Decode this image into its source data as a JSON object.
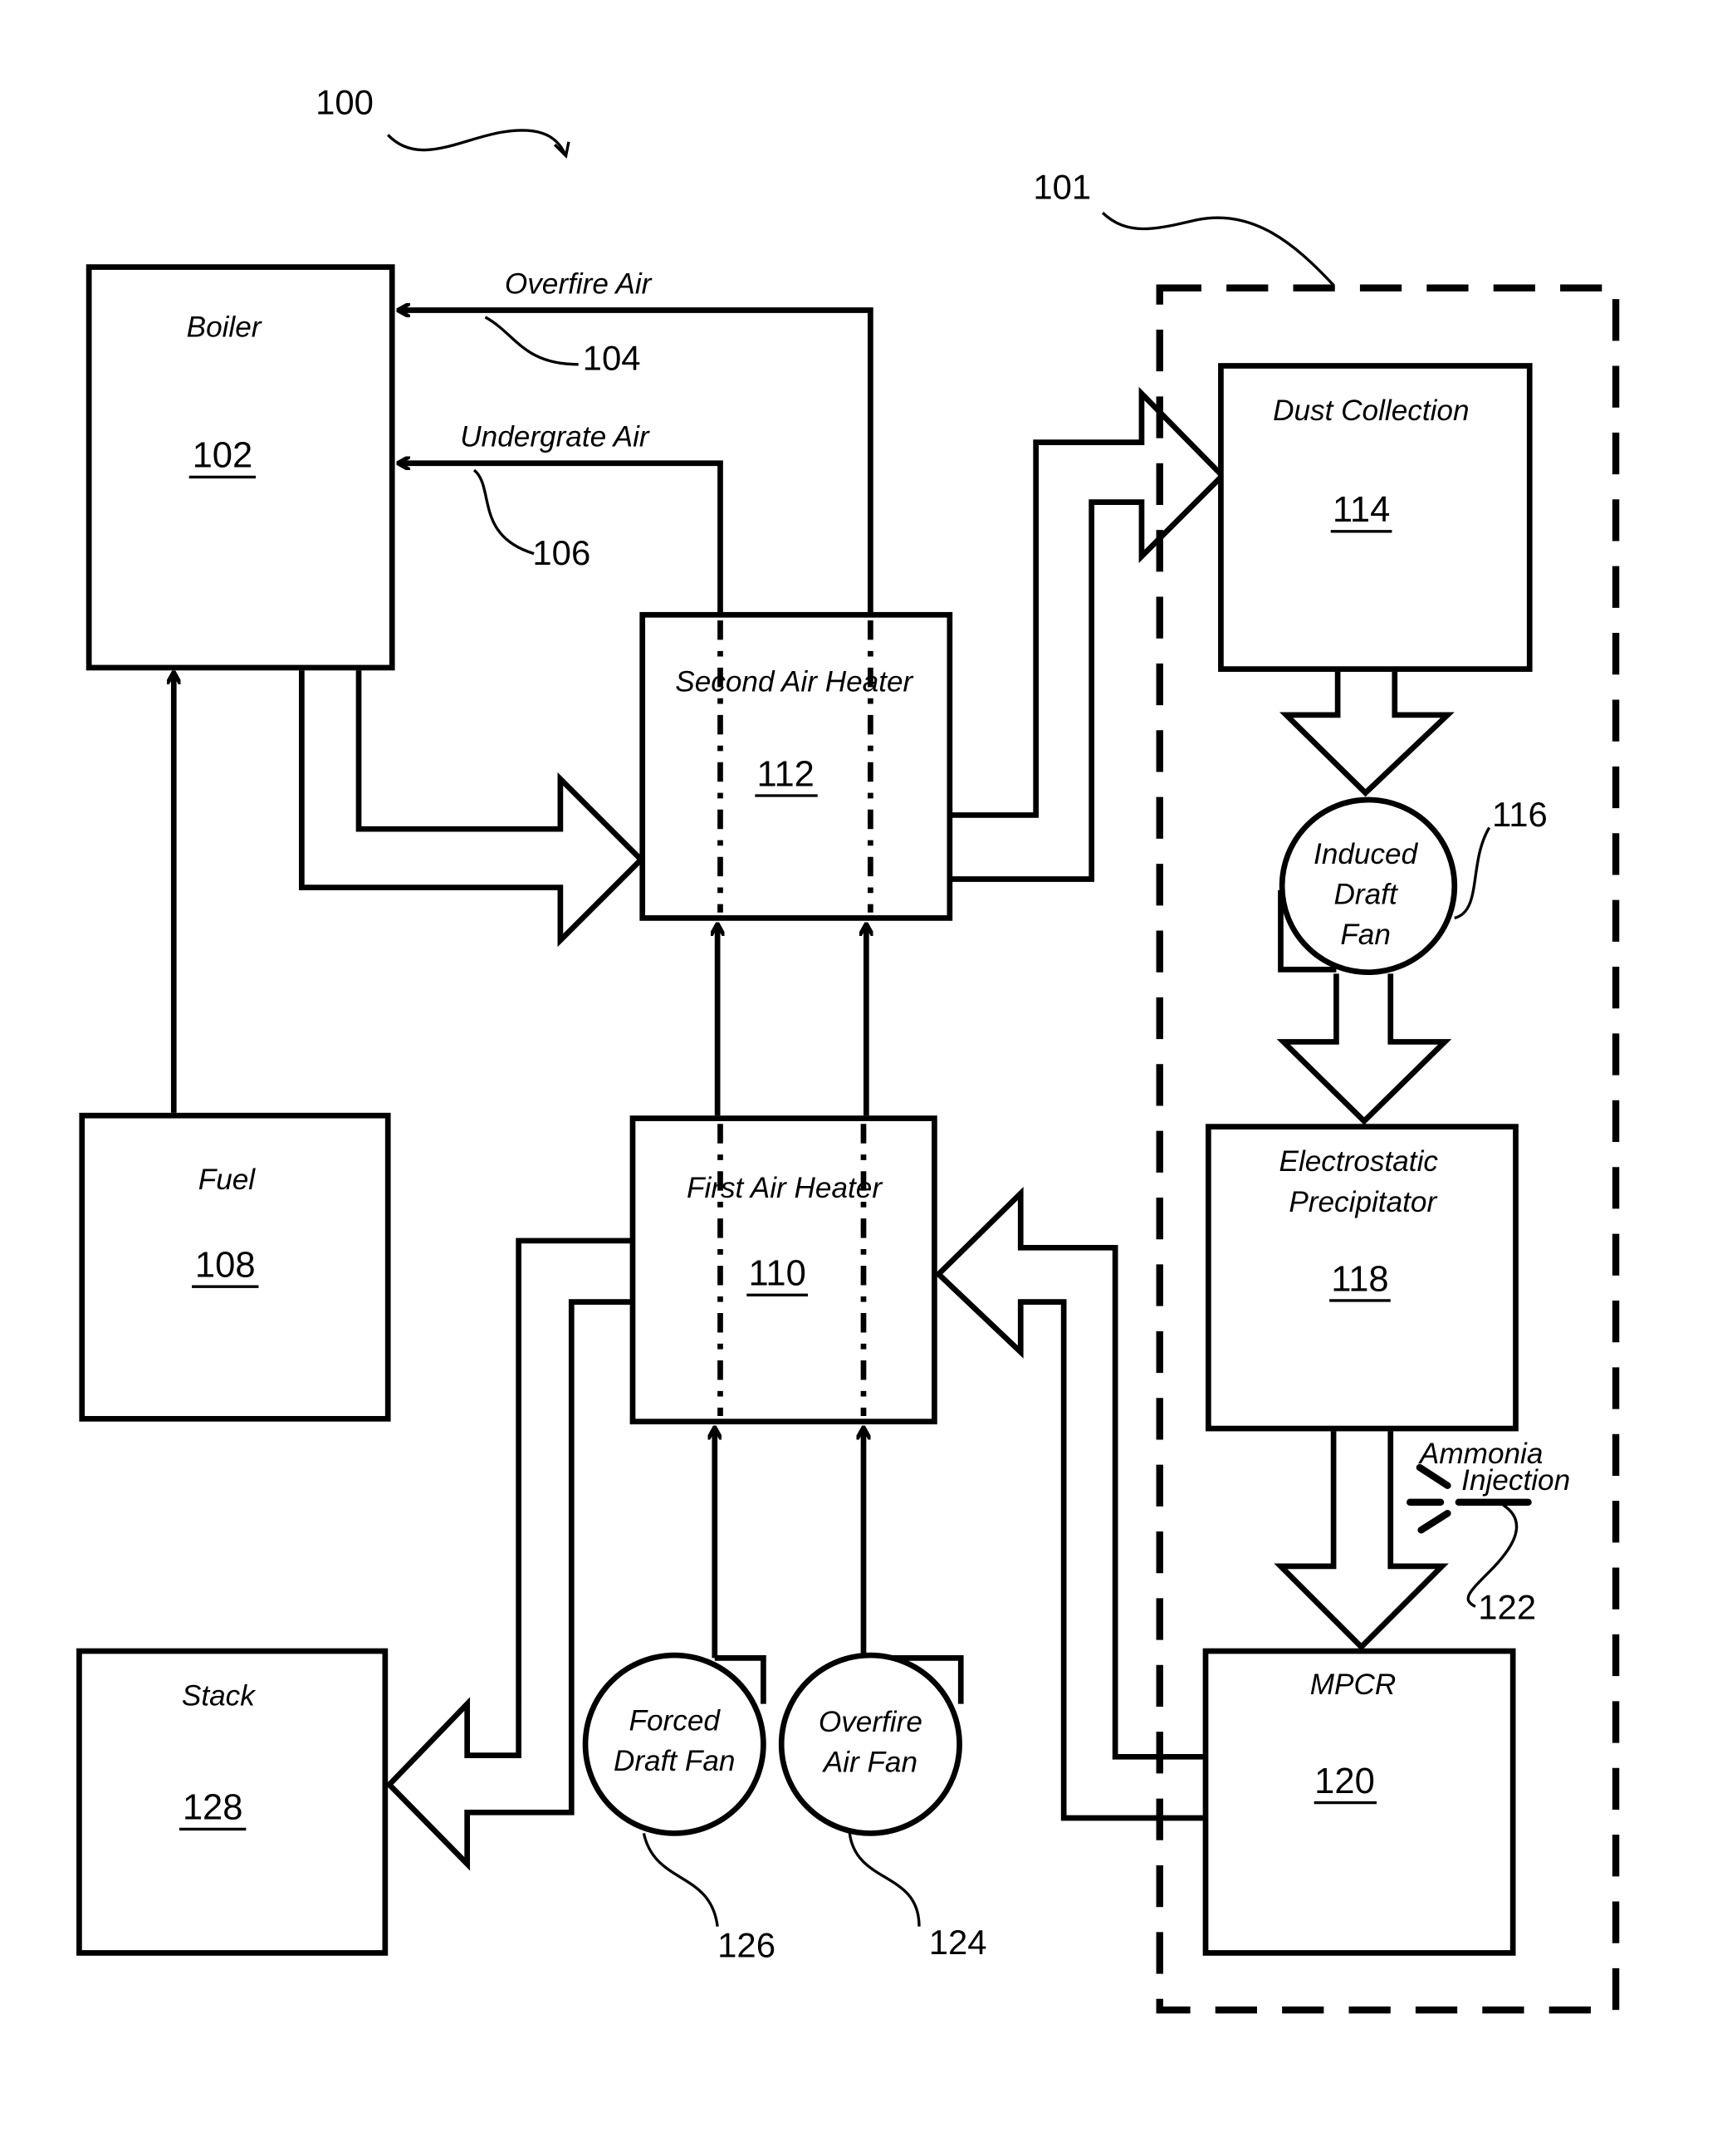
{
  "figure": {
    "ref_system": "100",
    "ref_group": "101",
    "blocks": {
      "boiler": {
        "label": "Boiler",
        "num": "102"
      },
      "fuel": {
        "label": "Fuel",
        "num": "108"
      },
      "stack": {
        "label": "Stack",
        "num": "128"
      },
      "second_air_heater": {
        "label": "Second Air Heater",
        "num": "112"
      },
      "first_air_heater": {
        "label": "First Air Heater",
        "num": "110"
      },
      "dust_collection": {
        "label": "Dust Collection",
        "num": "114"
      },
      "esp": {
        "label1": "Electrostatic",
        "label2": "Precipitator",
        "num": "118"
      },
      "mpcr": {
        "label": "MPCR",
        "num": "120"
      }
    },
    "fans": {
      "induced": {
        "l1": "Induced",
        "l2": "Draft",
        "l3": "Fan",
        "ref": "116"
      },
      "forced": {
        "l1": "Forced",
        "l2": "Draft Fan",
        "ref": "126"
      },
      "overfire": {
        "l1": "Overfire",
        "l2": "Air Fan",
        "ref": "124"
      }
    },
    "flows": {
      "overfire_air": {
        "label": "Overfire Air",
        "ref": "104"
      },
      "undergrate_air": {
        "label": "Undergrate Air",
        "ref": "106"
      },
      "ammonia": {
        "l1": "Ammonia",
        "l2": "Injection",
        "ref": "122"
      }
    }
  }
}
